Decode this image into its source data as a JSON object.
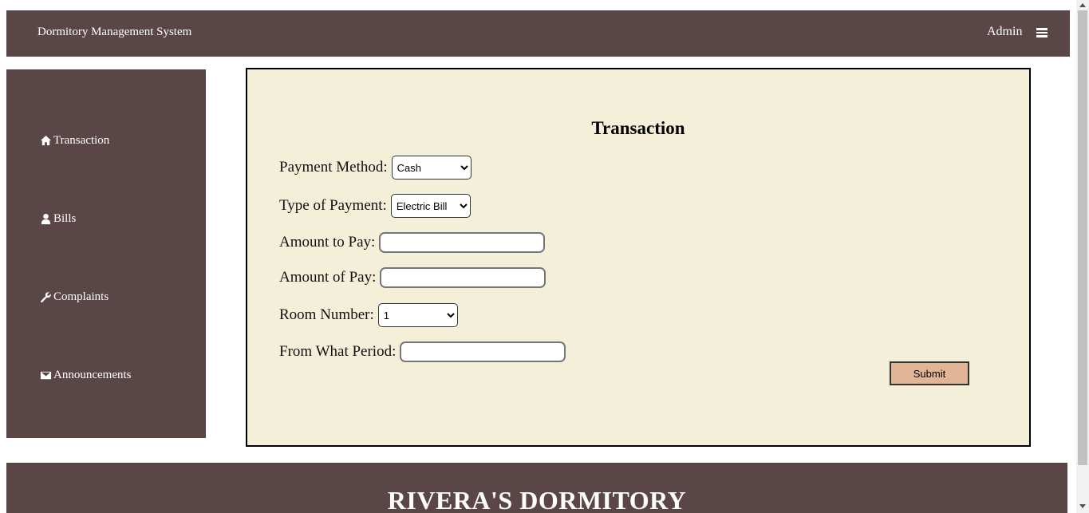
{
  "header": {
    "brand": "Dormitory Management System",
    "user": "Admin",
    "menu_icon": "hamburger-icon"
  },
  "sidebar": {
    "items": [
      {
        "label": "Transaction",
        "icon": "home-icon"
      },
      {
        "label": "Bills",
        "icon": "user-icon"
      },
      {
        "label": "Complaints",
        "icon": "wrench-icon"
      },
      {
        "label": "Announcements",
        "icon": "envelope-icon"
      }
    ]
  },
  "form": {
    "title": "Transaction",
    "payment_method": {
      "label": "Payment Method:",
      "value": "Cash"
    },
    "payment_type": {
      "label": "Type of Payment:",
      "value": "Electric Bill"
    },
    "amount_to_pay": {
      "label": "Amount to Pay:",
      "value": ""
    },
    "amount_of_pay": {
      "label": "Amount of Pay:",
      "value": ""
    },
    "room_number": {
      "label": "Room Number:",
      "value": "1"
    },
    "period": {
      "label": "From What Period:",
      "value": ""
    },
    "submit_label": "Submit"
  },
  "footer": {
    "title": "RIVERA'S DORMITORY"
  },
  "colors": {
    "brand_brown": "#5b4647",
    "panel_bg": "#f3efd9",
    "submit_bg": "#e3b597"
  }
}
